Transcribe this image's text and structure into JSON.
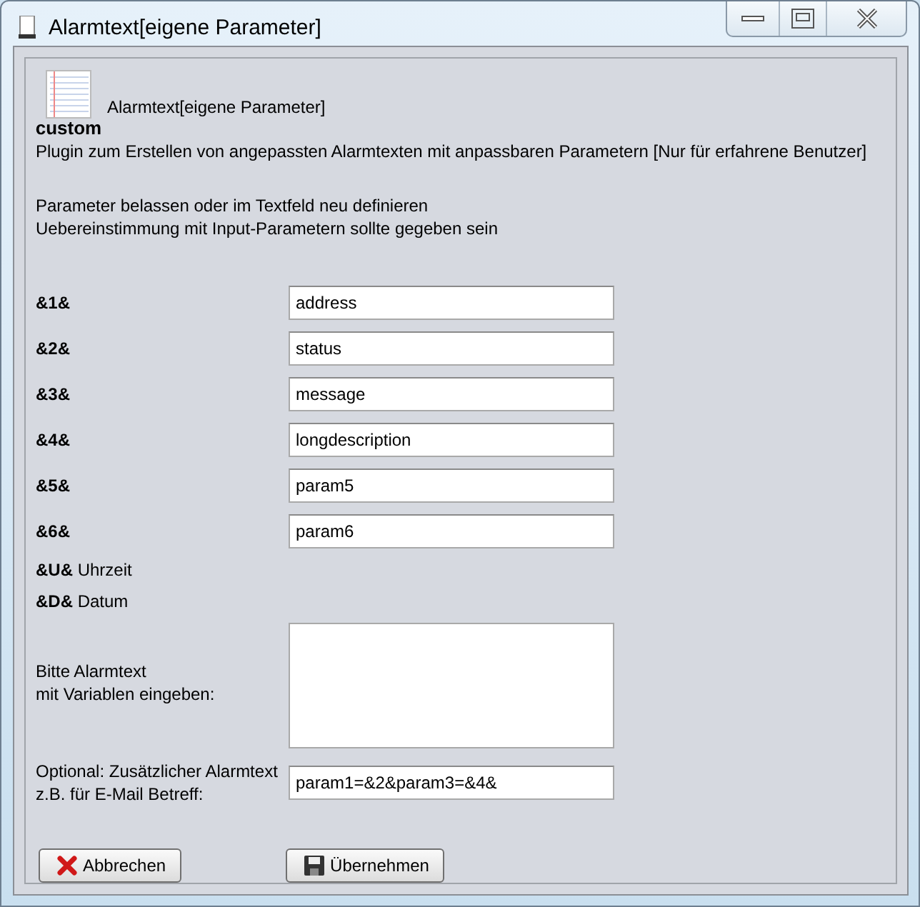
{
  "window": {
    "title": "Alarmtext[eigene Parameter]"
  },
  "header": {
    "icon_caption": "custom",
    "title": "Alarmtext[eigene Parameter]",
    "description": "Plugin zum Erstellen von angepassten Alarmtexten mit anpassbaren Parametern [Nur für erfahrene Benutzer]"
  },
  "hint_lines": [
    "Parameter belassen oder im Textfeld neu definieren",
    "Uebereinstimmung mit Input-Parametern sollte gegeben sein"
  ],
  "parameters": [
    {
      "label": "&1&",
      "value": "address"
    },
    {
      "label": "&2&",
      "value": "status"
    },
    {
      "label": "&3&",
      "value": "message"
    },
    {
      "label": "&4&",
      "value": "longdescription"
    },
    {
      "label": "&5&",
      "value": "param5"
    },
    {
      "label": "&6&",
      "value": "param6"
    }
  ],
  "variables": [
    "**&U&** Uhrzeit",
    "**&D&** Datum"
  ],
  "alarm_text": {
    "label_lines": [
      "Bitte Alarmtext",
      "mit Variablen eingeben:"
    ]
  },
  "extra_text": {
    "label_lines": [
      "Optional: Zusätzlicher Alarmtext",
      "z.B. für E-Mail Betreff:"
    ],
    "value": "param1=&2&param3=&4&"
  },
  "buttons": [
    {
      "kind": "cancel",
      "label": "Abbrechen"
    },
    {
      "kind": "save",
      "label": "Übernehmen"
    }
  ]
}
